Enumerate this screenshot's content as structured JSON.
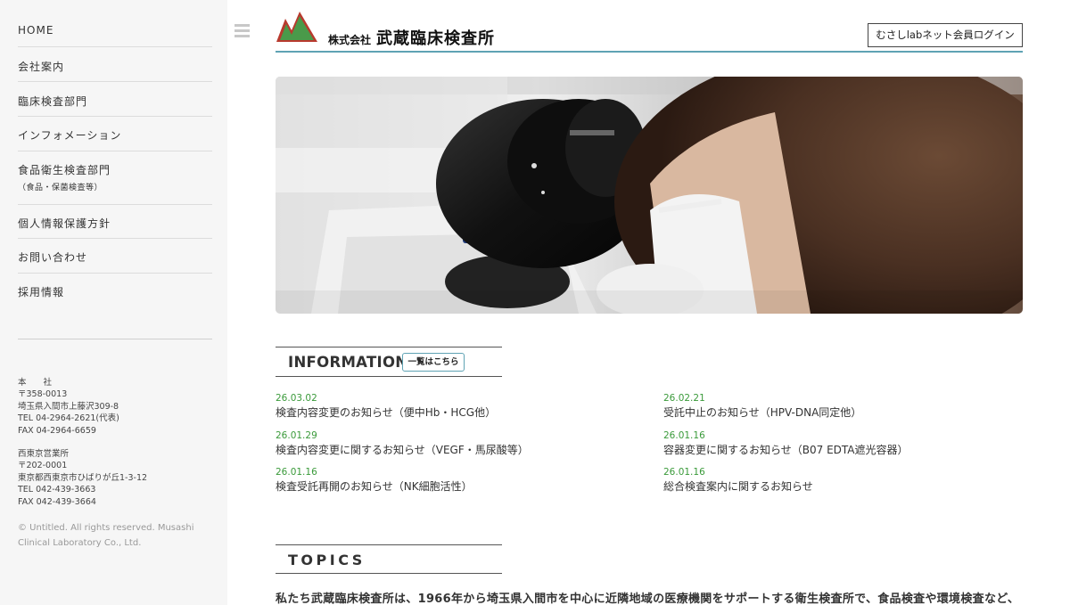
{
  "sidebar": {
    "nav": [
      {
        "label": "HOME"
      },
      {
        "label": "会社案内"
      },
      {
        "label": "臨床検査部門"
      },
      {
        "label": "インフォメーション"
      },
      {
        "label": "食品衛生検査部門",
        "sub": "（食品・保菌検査等）"
      },
      {
        "label": "個人情報保護方針"
      },
      {
        "label": "お問い合わせ"
      },
      {
        "label": "採用情報"
      }
    ],
    "head_office": {
      "title": "本　　社",
      "zip": "〒358-0013",
      "address": "埼玉県入間市上藤沢309-8",
      "tel": "TEL 04-2964-2621(代表)",
      "fax": "FAX 04-2964-6659"
    },
    "branch_office": {
      "title": "西東京営業所",
      "zip": "〒202-0001",
      "address": "東京都西東京市ひばりが丘1-3-12",
      "tel": "TEL 042-439-3663",
      "fax": "FAX 042-439-3664"
    },
    "copyright": "© Untitled. All rights reserved. Musashi Clinical Laboratory Co., Ltd."
  },
  "header": {
    "company_prefix": "株式会社",
    "company_name": "武蔵臨床検査所",
    "login_label": "むさしlabネット会員ログイン"
  },
  "information": {
    "title": "INFORMATION",
    "list_button": "一覧はこちら",
    "items": [
      {
        "date": "26.03.02",
        "title": "検査内容変更のお知らせ（便中Hb・HCG他）"
      },
      {
        "date": "26.02.21",
        "title": "受託中止のお知らせ（HPV-DNA同定他）"
      },
      {
        "date": "26.01.29",
        "title": "検査内容変更に関するお知らせ（VEGF・馬尿酸等）"
      },
      {
        "date": "26.01.16",
        "title": "容器変更に関するお知らせ（B07 EDTA遮光容器）"
      },
      {
        "date": "26.01.16",
        "title": "検査受託再開のお知らせ（NK細胞活性）"
      },
      {
        "date": "26.01.16",
        "title": "総合検査案内に関するお知らせ"
      }
    ]
  },
  "topics": {
    "title": "TOPICS",
    "intro": "私たち武蔵臨床検査所は、1966年から埼玉県入間市を中心に近隣地域の医療機関をサポートする衛生検査所で、食品検査や環境検査など、"
  },
  "colors": {
    "accent": "#5fa3b4",
    "date_green": "#3a9a3a",
    "logo_green": "#4a9a4a",
    "logo_red": "#b83a2e"
  },
  "icons": {
    "menu": "hamburger-icon",
    "logo": "mountain-logo-icon"
  }
}
